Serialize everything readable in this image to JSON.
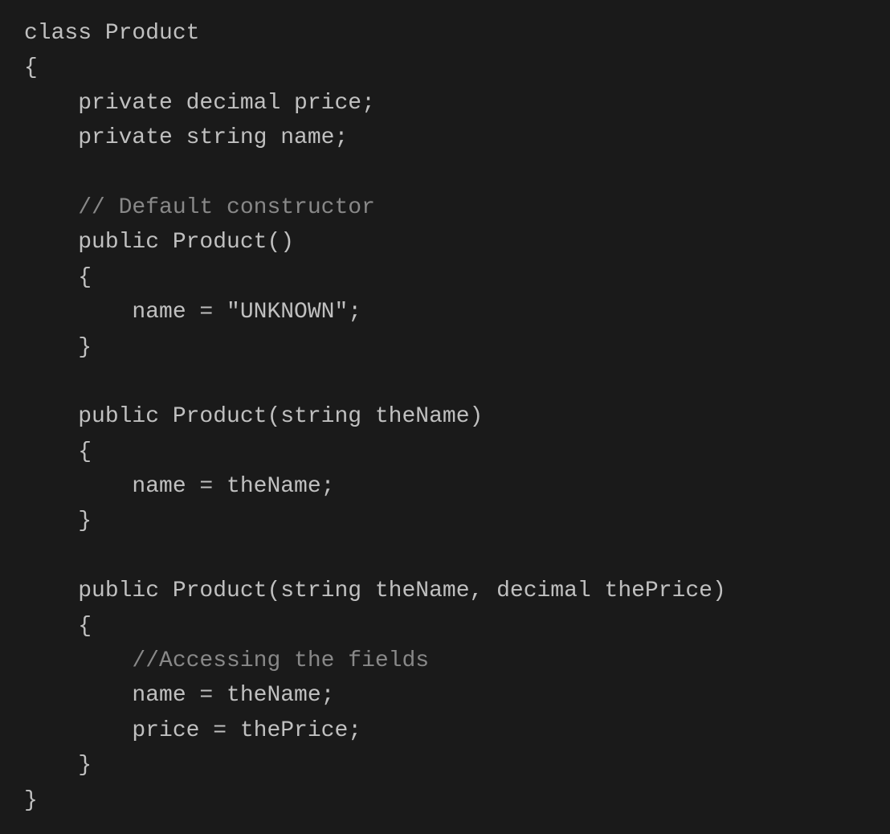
{
  "code": {
    "lines": [
      {
        "text": "class Product",
        "type": "code"
      },
      {
        "text": "{",
        "type": "code"
      },
      {
        "text": "    private decimal price;",
        "type": "code"
      },
      {
        "text": "    private string name;",
        "type": "code"
      },
      {
        "text": "",
        "type": "code"
      },
      {
        "text": "    // Default constructor",
        "type": "comment"
      },
      {
        "text": "    public Product()",
        "type": "code"
      },
      {
        "text": "    {",
        "type": "code"
      },
      {
        "text": "        name = \"UNKNOWN\";",
        "type": "code"
      },
      {
        "text": "    }",
        "type": "code"
      },
      {
        "text": "",
        "type": "code"
      },
      {
        "text": "    public Product(string theName)",
        "type": "code"
      },
      {
        "text": "    {",
        "type": "code"
      },
      {
        "text": "        name = theName;",
        "type": "code"
      },
      {
        "text": "    }",
        "type": "code"
      },
      {
        "text": "",
        "type": "code"
      },
      {
        "text": "    public Product(string theName, decimal thePrice)",
        "type": "code"
      },
      {
        "text": "    {",
        "type": "code"
      },
      {
        "text": "        //Accessing the fields",
        "type": "comment"
      },
      {
        "text": "        name = theName;",
        "type": "code"
      },
      {
        "text": "        price = thePrice;",
        "type": "code"
      },
      {
        "text": "    }",
        "type": "code"
      },
      {
        "text": "}",
        "type": "code"
      }
    ]
  }
}
